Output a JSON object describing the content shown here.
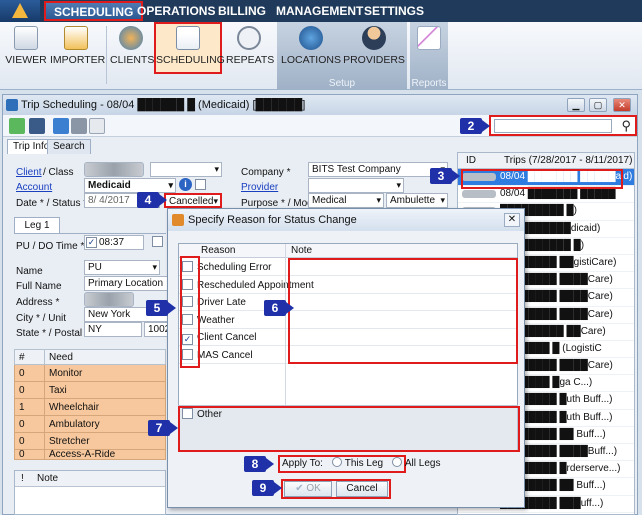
{
  "menu": [
    "SCHEDULING",
    "OPERATIONS",
    "BILLING",
    "MANAGEMENT",
    "SETTINGS"
  ],
  "ribbon": {
    "buttons": [
      "VIEWER",
      "IMPORTER",
      "CLIENTS",
      "SCHEDULING",
      "REPEATS",
      "LOCATIONS",
      "PROVIDERS"
    ],
    "groups": [
      "Setup",
      "Reports"
    ]
  },
  "window": {
    "title": "Trip Scheduling - 08/04 ██████ █ (Medicaid) [██████]",
    "tabs": [
      "Trip Info",
      "Search"
    ]
  },
  "form": {
    "client_label": "Client",
    "class_label": " / Class",
    "account_label": "Account",
    "account_value": "Medicaid",
    "date_status_label": "Date * / Status *",
    "date_value": "8/ 4/2017",
    "status_value": "Cancelled",
    "company_label": "Company *",
    "company_value": "BITS Test Company",
    "provider_label": "Provider",
    "purpose_mode_label": "Purpose * / Mode *",
    "purpose_value": "Medical",
    "mode_value": "Ambulette",
    "leg_tab": "Leg 1",
    "pu_do_time_label": "PU / DO Time *",
    "pu_time": "08:37",
    "name_label": "Name",
    "name_value": "PU",
    "full_name_label": "Full Name",
    "full_name_value": "Primary Location",
    "address_label": "Address *",
    "city_unit_label": "City * / Unit",
    "city_value": "New York",
    "state_postal_label": "State * / Postal *",
    "state_value": "NY",
    "postal_value": "10028"
  },
  "needs": {
    "headers": [
      "#",
      "Need"
    ],
    "rows": [
      [
        "0",
        "Monitor"
      ],
      [
        "0",
        "Taxi"
      ],
      [
        "1",
        "Wheelchair"
      ],
      [
        "0",
        "Ambulatory"
      ],
      [
        "0",
        "Stretcher"
      ],
      [
        "0",
        "Access-A-Ride"
      ]
    ]
  },
  "notes": {
    "headers": [
      "!",
      "Note"
    ]
  },
  "trips": {
    "header_id": "ID",
    "header_trips": "Trips (7/28/2017 - 8/11/2017)",
    "rows": [
      "08/04 ███████ █████aid)",
      "08/04 ███████ █████",
      "█████████ █)",
      "██████████dicaid)",
      "██████████ █)",
      "████████ ██gistiCare)",
      "████████ ████Care)",
      "████████ ████Care)",
      "████████ ████Care)",
      "█████████ ██Care)",
      "███████ █ (LogistiC",
      "████████ ████Care)",
      "███████ █ga C...)",
      "████████ █uth Buff...)",
      "████████ █uth Buff...)",
      "████████ ██ Buff...)",
      "████████ ████Buff...)",
      "████████ █rderserve...)",
      "████████ ██ Buff...)",
      "████████ ███uff...)"
    ]
  },
  "dialog": {
    "title": "Specify Reason for Status Change",
    "col_reason": "Reason",
    "col_note": "Note",
    "reasons": [
      {
        "label": "Scheduling Error",
        "checked": false
      },
      {
        "label": "Rescheduled Appointment",
        "checked": false
      },
      {
        "label": "Driver Late",
        "checked": false
      },
      {
        "label": "Weather",
        "checked": false
      },
      {
        "label": "Client Cancel",
        "checked": true
      },
      {
        "label": "MAS Cancel",
        "checked": false
      }
    ],
    "other_label": "Other",
    "apply_to_label": "Apply To:",
    "this_leg": "This Leg",
    "all_legs": "All Legs",
    "ok": "OK",
    "cancel": "Cancel"
  },
  "callouts": [
    "2",
    "3",
    "4",
    "5",
    "6",
    "7",
    "8",
    "9"
  ],
  "colors": {
    "highlight_red": "#e01b1b",
    "callout_blue": "#2030a8",
    "selection_blue": "#2f7ce0",
    "need_orange": "#f7c89d"
  }
}
